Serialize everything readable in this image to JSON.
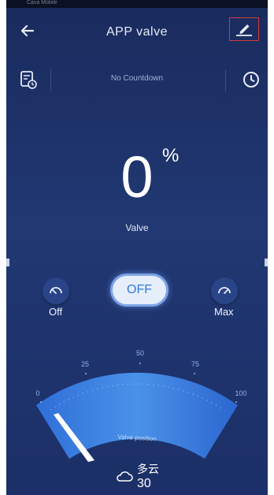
{
  "status_bar": {
    "carrier": "Cava Mobile"
  },
  "header": {
    "title": "APP  valve"
  },
  "countdown": {
    "text": "No Countdown"
  },
  "valve": {
    "value": "0",
    "unit": "%",
    "label": "Valve"
  },
  "controls": {
    "off_label": "Off",
    "toggle_label": "OFF",
    "max_label": "Max"
  },
  "gauge": {
    "label": "Valve position",
    "ticks": [
      "0",
      "25",
      "50",
      "75",
      "100"
    ],
    "current_percent": 0
  },
  "weather": {
    "condition": "多云",
    "temperature": "30"
  },
  "colors": {
    "background": "#1c2f67",
    "accent": "#2f7ae0",
    "highlight_border": "#d23b3b"
  }
}
